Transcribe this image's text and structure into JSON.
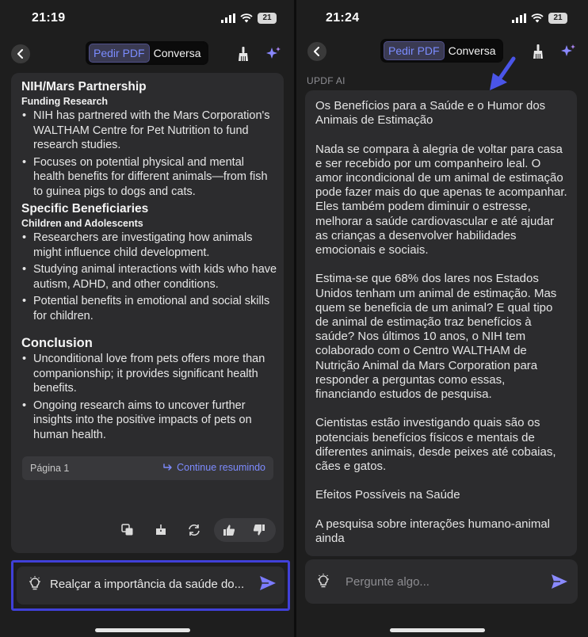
{
  "left": {
    "status": {
      "time": "21:19",
      "battery": "21"
    },
    "tabs": {
      "pdf": "Pedir PDF",
      "chat": "Conversa"
    },
    "summary": {
      "sections": [
        {
          "title": "NIH/Mars Partnership",
          "subtitle": "Funding Research",
          "bullets": [
            "NIH has partnered with the Mars Corporation's WALTHAM Centre for Pet Nutrition to fund research studies.",
            "Focuses on potential physical and mental health benefits for different animals—from fish to guinea pigs to dogs and cats."
          ]
        },
        {
          "title": "Specific Beneficiaries",
          "subtitle": "Children and Adolescents",
          "bullets": [
            "Researchers are investigating how animals might influence child development.",
            "Studying animal interactions with kids who have autism, ADHD, and other conditions.",
            "Potential benefits in emotional and social skills for children."
          ]
        }
      ],
      "conclusion": {
        "title": "Conclusion",
        "bullets": [
          "Unconditional love from pets offers more than companionship; it provides significant health benefits.",
          "Ongoing research aims to uncover further insights into the positive impacts of pets on human health."
        ]
      },
      "page_label": "Página 1",
      "continue_label": "Continue resumindo"
    },
    "input_value": "Realçar a importância da saúde do..."
  },
  "right": {
    "status": {
      "time": "21:24",
      "battery": "21"
    },
    "tabs": {
      "pdf": "Pedir PDF",
      "chat": "Conversa"
    },
    "ai_label": "UPDF AI",
    "response": {
      "p1": "Os Benefícios para a Saúde e o Humor dos Animais de Estimação",
      "p2": "Nada se compara à alegria de voltar para casa e ser recebido por um companheiro leal. O amor incondicional de um animal de estimação pode fazer mais do que apenas te acompanhar. Eles também podem diminuir o estresse, melhorar a saúde cardiovascular e até ajudar as crianças a desenvolver habilidades emocionais e sociais.",
      "p3": "Estima-se que 68% dos lares nos Estados Unidos tenham um animal de estimação. Mas quem se beneficia de um animal? E qual tipo de animal de estimação traz benefícios à saúde? Nos últimos 10 anos, o NIH tem colaborado com o Centro WALTHAM de Nutrição Animal da Mars Corporation para responder a perguntas como essas, financiando estudos de pesquisa.",
      "p4": "Cientistas estão investigando quais são os potenciais benefícios físicos e mentais de diferentes animais, desde peixes até cobaias, cães e gatos.",
      "p5": "Efeitos Possíveis na Saúde",
      "p6": "A pesquisa sobre interações humano-animal ainda"
    },
    "input_placeholder": "Pergunte algo..."
  },
  "colors": {
    "accent": "#7b8cff",
    "highlight_border": "#4040d8",
    "annotation_arrow": "#4a55e8",
    "card": "#2c2c2e",
    "background": "#1e1e1e"
  }
}
